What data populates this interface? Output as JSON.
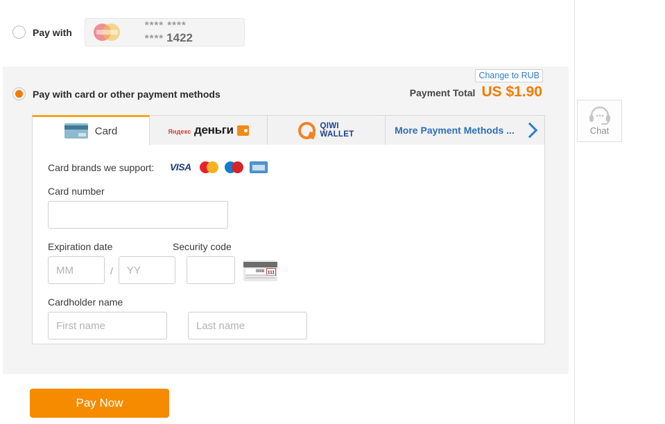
{
  "saved_card": {
    "radio_label": "Pay with",
    "selected": false,
    "brand_icon": "mastercard-icon",
    "masked_number": "**** **** ****",
    "last4": "1422"
  },
  "panel": {
    "radio_label": "Pay with card or other payment methods",
    "selected": true,
    "change_currency": "Change to RUB",
    "total_label": "Payment Total",
    "total_amount": "US $1.90",
    "accent_color": "#f47b00",
    "link_color": "#2d7dd2"
  },
  "tabs": [
    {
      "id": "card",
      "label": "Card",
      "icon": "credit-card-icon",
      "active": true
    },
    {
      "id": "yandex",
      "label": "",
      "icon": "yandex-money-icon",
      "logo_top": "Яндекс",
      "logo_bottom": "деньги",
      "active": false
    },
    {
      "id": "qiwi",
      "label": "",
      "icon": "qiwi-wallet-icon",
      "logo_line1": "QIWI",
      "logo_line2": "WALLET",
      "active": false
    },
    {
      "id": "more",
      "label": "More Payment Methods ...",
      "icon": "chevron-right-icon",
      "active": false
    }
  ],
  "form": {
    "brands_label": "Card brands we support:",
    "brands": [
      "VISA",
      "Mastercard",
      "Maestro",
      "American Express"
    ],
    "visa_text": "VISA",
    "card_number_label": "Card number",
    "card_number_value": "",
    "card_number_placeholder": "",
    "expiration_label": "Expiration date",
    "month_placeholder": "MM",
    "month_value": "",
    "separator": "/",
    "year_placeholder": "YY",
    "year_value": "",
    "security_label": "Security code",
    "security_value": "",
    "security_placeholder": "",
    "cvv_hint_signature": "0008",
    "cvv_hint_code": "111",
    "cardholder_label": "Cardholder name",
    "first_name_placeholder": "First name",
    "first_name_value": "",
    "last_name_placeholder": "Last name",
    "last_name_value": ""
  },
  "actions": {
    "pay_now": "Pay Now"
  },
  "chat": {
    "label": "Chat",
    "icon": "headset-icon"
  }
}
